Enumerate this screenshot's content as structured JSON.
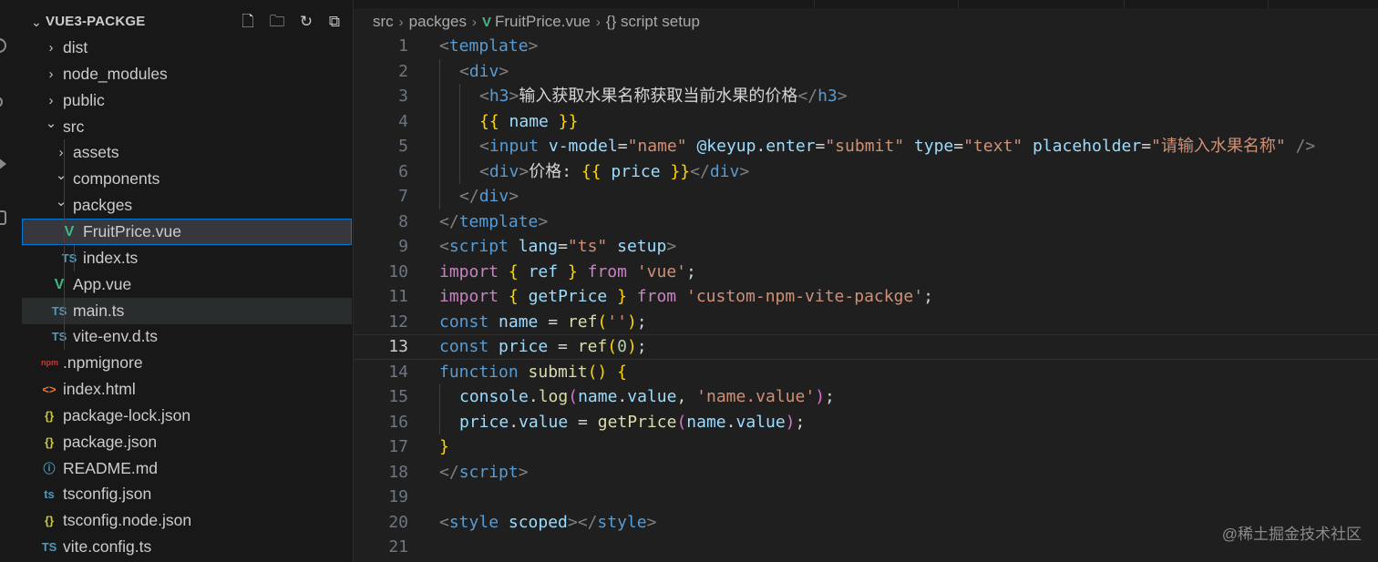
{
  "activity_bar": {
    "icons": [
      "search-icon",
      "source-control-icon",
      "run-debug-icon",
      "extensions-icon"
    ]
  },
  "explorer": {
    "title": "VUE3-PACKGE",
    "actions": [
      {
        "name": "new-file-icon",
        "glyph": "🗋"
      },
      {
        "name": "new-folder-icon",
        "glyph": "🗀"
      },
      {
        "name": "refresh-icon",
        "glyph": "↻"
      },
      {
        "name": "collapse-all-icon",
        "glyph": "⧉"
      }
    ],
    "tree": [
      {
        "label": "dist",
        "depth": 0,
        "kind": "folder",
        "open": false
      },
      {
        "label": "node_modules",
        "depth": 0,
        "kind": "folder",
        "open": false
      },
      {
        "label": "public",
        "depth": 0,
        "kind": "folder",
        "open": false
      },
      {
        "label": "src",
        "depth": 0,
        "kind": "folder",
        "open": true
      },
      {
        "label": "assets",
        "depth": 1,
        "kind": "folder",
        "open": false
      },
      {
        "label": "components",
        "depth": 1,
        "kind": "folder",
        "open": true
      },
      {
        "label": "packges",
        "depth": 1,
        "kind": "folder",
        "open": true
      },
      {
        "label": "FruitPrice.vue",
        "depth": 2,
        "kind": "vue",
        "state": "selected"
      },
      {
        "label": "index.ts",
        "depth": 2,
        "kind": "ts"
      },
      {
        "label": "App.vue",
        "depth": 1,
        "kind": "vue"
      },
      {
        "label": "main.ts",
        "depth": 1,
        "kind": "ts",
        "state": "hover"
      },
      {
        "label": "vite-env.d.ts",
        "depth": 1,
        "kind": "ts"
      },
      {
        "label": ".npmignore",
        "depth": 0,
        "kind": "npm"
      },
      {
        "label": "index.html",
        "depth": 0,
        "kind": "html"
      },
      {
        "label": "package-lock.json",
        "depth": 0,
        "kind": "json"
      },
      {
        "label": "package.json",
        "depth": 0,
        "kind": "json"
      },
      {
        "label": "README.md",
        "depth": 0,
        "kind": "info"
      },
      {
        "label": "tsconfig.json",
        "depth": 0,
        "kind": "tsconfig"
      },
      {
        "label": "tsconfig.node.json",
        "depth": 0,
        "kind": "json"
      },
      {
        "label": "vite.config.ts",
        "depth": 0,
        "kind": "ts"
      }
    ]
  },
  "icon_glyphs": {
    "vue": "V",
    "ts": "TS",
    "npm": "npm",
    "html": "<>",
    "json": "{}",
    "info": "ⓘ",
    "tsconfig": "ts"
  },
  "icon_colors": {
    "vue": "#41b883",
    "ts": "#519aba",
    "npm": "#cb3837",
    "html": "#e37933",
    "json": "#cbcb41",
    "info": "#519aba",
    "tsconfig": "#519aba"
  },
  "breadcrumb": {
    "parts": [
      "src",
      "packges",
      "FruitPrice.vue",
      "{} script setup"
    ]
  },
  "editor": {
    "current_line": 13,
    "lines": [
      {
        "n": 1,
        "indent": 0,
        "tokens": [
          [
            "t-punc",
            "<"
          ],
          [
            "t-tag",
            "template"
          ],
          [
            "t-punc",
            ">"
          ]
        ]
      },
      {
        "n": 2,
        "indent": 1,
        "tokens": [
          [
            "t-punc",
            "<"
          ],
          [
            "t-tag",
            "div"
          ],
          [
            "t-punc",
            ">"
          ]
        ]
      },
      {
        "n": 3,
        "indent": 2,
        "tokens": [
          [
            "t-punc",
            "<"
          ],
          [
            "t-tag",
            "h3"
          ],
          [
            "t-punc",
            ">"
          ],
          [
            "t-txt",
            "输入获取水果名称获取当前水果的价格"
          ],
          [
            "t-punc",
            "</"
          ],
          [
            "t-tag",
            "h3"
          ],
          [
            "t-punc",
            ">"
          ]
        ]
      },
      {
        "n": 4,
        "indent": 2,
        "tokens": [
          [
            "t-br1",
            "{{"
          ],
          [
            "t-txt",
            " "
          ],
          [
            "t-var",
            "name"
          ],
          [
            "t-txt",
            " "
          ],
          [
            "t-br1",
            "}}"
          ]
        ]
      },
      {
        "n": 5,
        "indent": 2,
        "tokens": [
          [
            "t-punc",
            "<"
          ],
          [
            "t-tag",
            "input"
          ],
          [
            "t-txt",
            " "
          ],
          [
            "t-attr",
            "v-model"
          ],
          [
            "t-txt",
            "="
          ],
          [
            "t-str",
            "\"name\""
          ],
          [
            "t-txt",
            " "
          ],
          [
            "t-attr",
            "@keyup.enter"
          ],
          [
            "t-txt",
            "="
          ],
          [
            "t-str",
            "\"submit\""
          ],
          [
            "t-txt",
            " "
          ],
          [
            "t-attr",
            "type"
          ],
          [
            "t-txt",
            "="
          ],
          [
            "t-str",
            "\"text\""
          ],
          [
            "t-txt",
            " "
          ],
          [
            "t-attr",
            "placeholder"
          ],
          [
            "t-txt",
            "="
          ],
          [
            "t-str",
            "\"请输入水果名称\""
          ],
          [
            "t-txt",
            " "
          ],
          [
            "t-punc",
            "/>"
          ]
        ]
      },
      {
        "n": 6,
        "indent": 2,
        "tokens": [
          [
            "t-punc",
            "<"
          ],
          [
            "t-tag",
            "div"
          ],
          [
            "t-punc",
            ">"
          ],
          [
            "t-txt",
            "价格: "
          ],
          [
            "t-br1",
            "{{"
          ],
          [
            "t-txt",
            " "
          ],
          [
            "t-var",
            "price"
          ],
          [
            "t-txt",
            " "
          ],
          [
            "t-br1",
            "}}"
          ],
          [
            "t-punc",
            "</"
          ],
          [
            "t-tag",
            "div"
          ],
          [
            "t-punc",
            ">"
          ]
        ]
      },
      {
        "n": 7,
        "indent": 1,
        "tokens": [
          [
            "t-punc",
            "</"
          ],
          [
            "t-tag",
            "div"
          ],
          [
            "t-punc",
            ">"
          ]
        ]
      },
      {
        "n": 8,
        "indent": 0,
        "tokens": [
          [
            "t-punc",
            "</"
          ],
          [
            "t-tag",
            "template"
          ],
          [
            "t-punc",
            ">"
          ]
        ]
      },
      {
        "n": 9,
        "indent": 0,
        "tokens": [
          [
            "t-punc",
            "<"
          ],
          [
            "t-tag",
            "script"
          ],
          [
            "t-txt",
            " "
          ],
          [
            "t-attr",
            "lang"
          ],
          [
            "t-txt",
            "="
          ],
          [
            "t-str",
            "\"ts\""
          ],
          [
            "t-txt",
            " "
          ],
          [
            "t-attr",
            "setup"
          ],
          [
            "t-punc",
            ">"
          ]
        ]
      },
      {
        "n": 10,
        "indent": 0,
        "tokens": [
          [
            "t-kw2",
            "import"
          ],
          [
            "t-txt",
            " "
          ],
          [
            "t-br1",
            "{"
          ],
          [
            "t-txt",
            " "
          ],
          [
            "t-var",
            "ref"
          ],
          [
            "t-txt",
            " "
          ],
          [
            "t-br1",
            "}"
          ],
          [
            "t-txt",
            " "
          ],
          [
            "t-kw2",
            "from"
          ],
          [
            "t-txt",
            " "
          ],
          [
            "t-str",
            "'vue'"
          ],
          [
            "t-txt",
            ";"
          ]
        ]
      },
      {
        "n": 11,
        "indent": 0,
        "tokens": [
          [
            "t-kw2",
            "import"
          ],
          [
            "t-txt",
            " "
          ],
          [
            "t-br1",
            "{"
          ],
          [
            "t-txt",
            " "
          ],
          [
            "t-var",
            "getPrice"
          ],
          [
            "t-txt",
            " "
          ],
          [
            "t-br1",
            "}"
          ],
          [
            "t-txt",
            " "
          ],
          [
            "t-kw2",
            "from"
          ],
          [
            "t-txt",
            " "
          ],
          [
            "t-str",
            "'custom-npm-vite-packge'"
          ],
          [
            "t-txt",
            ";"
          ]
        ]
      },
      {
        "n": 12,
        "indent": 0,
        "tokens": [
          [
            "t-kw",
            "const"
          ],
          [
            "t-txt",
            " "
          ],
          [
            "t-var",
            "name"
          ],
          [
            "t-txt",
            " = "
          ],
          [
            "t-fn",
            "ref"
          ],
          [
            "t-br1",
            "("
          ],
          [
            "t-str",
            "''"
          ],
          [
            "t-br1",
            ")"
          ],
          [
            "t-txt",
            ";"
          ]
        ]
      },
      {
        "n": 13,
        "indent": 0,
        "tokens": [
          [
            "t-kw",
            "const"
          ],
          [
            "t-txt",
            " "
          ],
          [
            "t-var",
            "price"
          ],
          [
            "t-txt",
            " = "
          ],
          [
            "t-fn",
            "ref"
          ],
          [
            "t-br1",
            "("
          ],
          [
            "t-num",
            "0"
          ],
          [
            "t-br1",
            ")"
          ],
          [
            "t-txt",
            ";"
          ]
        ]
      },
      {
        "n": 14,
        "indent": 0,
        "tokens": [
          [
            "t-kw",
            "function"
          ],
          [
            "t-txt",
            " "
          ],
          [
            "t-fn",
            "submit"
          ],
          [
            "t-br1",
            "()"
          ],
          [
            "t-txt",
            " "
          ],
          [
            "t-br1",
            "{"
          ]
        ]
      },
      {
        "n": 15,
        "indent": 1,
        "tokens": [
          [
            "t-var",
            "console"
          ],
          [
            "t-txt",
            "."
          ],
          [
            "t-fn",
            "log"
          ],
          [
            "t-br2",
            "("
          ],
          [
            "t-var",
            "name"
          ],
          [
            "t-txt",
            "."
          ],
          [
            "t-var",
            "value"
          ],
          [
            "t-txt",
            ", "
          ],
          [
            "t-str",
            "'name.value'"
          ],
          [
            "t-br2",
            ")"
          ],
          [
            "t-txt",
            ";"
          ]
        ]
      },
      {
        "n": 16,
        "indent": 1,
        "tokens": [
          [
            "t-var",
            "price"
          ],
          [
            "t-txt",
            "."
          ],
          [
            "t-var",
            "value"
          ],
          [
            "t-txt",
            " = "
          ],
          [
            "t-fn",
            "getPrice"
          ],
          [
            "t-br2",
            "("
          ],
          [
            "t-var",
            "name"
          ],
          [
            "t-txt",
            "."
          ],
          [
            "t-var",
            "value"
          ],
          [
            "t-br2",
            ")"
          ],
          [
            "t-txt",
            ";"
          ]
        ]
      },
      {
        "n": 17,
        "indent": 0,
        "tokens": [
          [
            "t-br1",
            "}"
          ]
        ]
      },
      {
        "n": 18,
        "indent": 0,
        "tokens": [
          [
            "t-punc",
            "</"
          ],
          [
            "t-tag",
            "script"
          ],
          [
            "t-punc",
            ">"
          ]
        ]
      },
      {
        "n": 19,
        "indent": 0,
        "tokens": []
      },
      {
        "n": 20,
        "indent": 0,
        "tokens": [
          [
            "t-punc",
            "<"
          ],
          [
            "t-tag",
            "style"
          ],
          [
            "t-txt",
            " "
          ],
          [
            "t-attr",
            "scoped"
          ],
          [
            "t-punc",
            "></"
          ],
          [
            "t-tag",
            "style"
          ],
          [
            "t-punc",
            ">"
          ]
        ]
      },
      {
        "n": 21,
        "indent": 0,
        "tokens": []
      }
    ]
  },
  "watermark": "@稀土掘金技术社区"
}
